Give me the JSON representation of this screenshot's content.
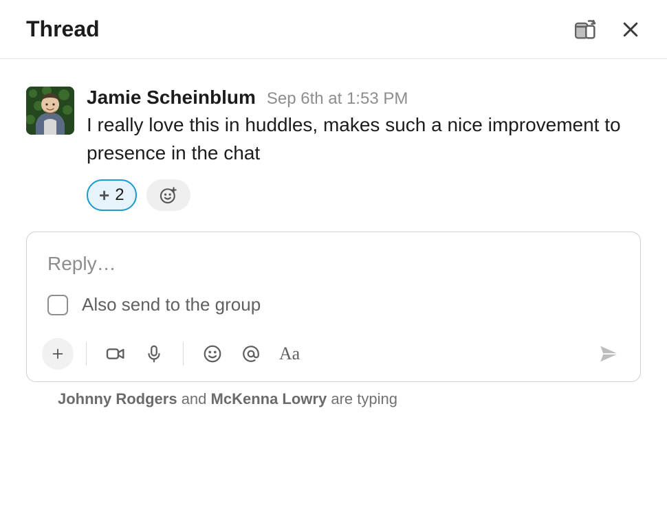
{
  "header": {
    "title": "Thread"
  },
  "message": {
    "author": "Jamie Scheinblum",
    "timestamp": "Sep 6th at 1:53 PM",
    "text": "I really love this in huddles, makes such a nice improvement to presence in the chat",
    "reaction_count": "2"
  },
  "composer": {
    "placeholder": "Reply…",
    "also_send_label": "Also send to the group"
  },
  "typing": {
    "name1": "Johnny Rodgers",
    "connector": " and ",
    "name2": "McKenna Lowry",
    "suffix": " are typing"
  }
}
